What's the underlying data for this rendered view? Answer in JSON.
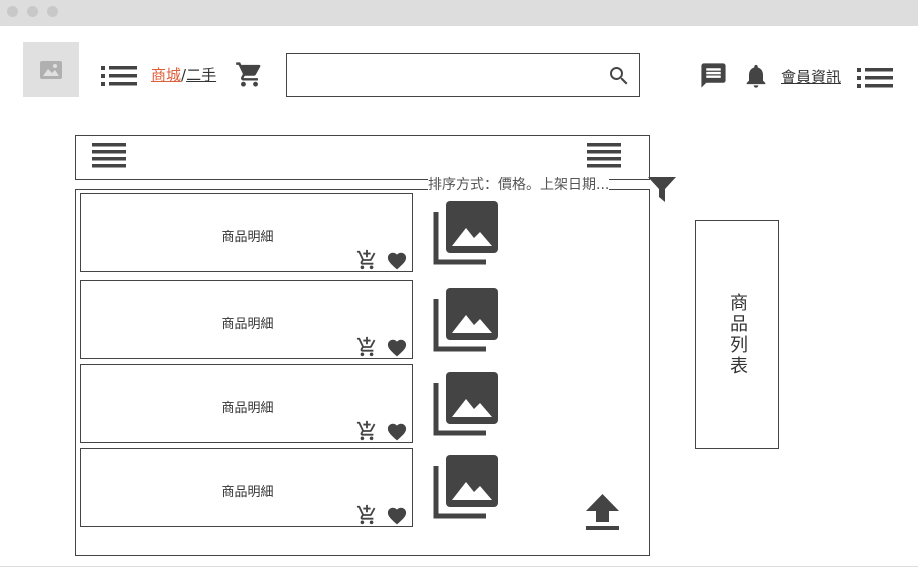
{
  "window": {
    "title": ""
  },
  "logo": {
    "icon": "image-placeholder-icon"
  },
  "header": {
    "menu_icon": "list-icon",
    "breadcrumb": {
      "active": "商城",
      "separator": "/",
      "next": "二手"
    },
    "cart_icon": "shopping-cart-icon",
    "search": {
      "value": "",
      "placeholder": "",
      "icon": "search-icon"
    },
    "message_icon": "message-icon",
    "bell_icon": "bell-icon",
    "member_label": "會員資訊",
    "right_menu_icon": "list-icon"
  },
  "toolbar": {
    "left_icon": "hamburger-icon",
    "right_icon": "hamburger-icon"
  },
  "sort": {
    "label": "排序方式：價格。上架日期...",
    "filter_icon": "filter-icon"
  },
  "products": [
    {
      "title": "商品明細",
      "cart_icon": "add-to-cart-icon",
      "fav_icon": "heart-icon",
      "image_icon": "photo-library-icon"
    },
    {
      "title": "商品明細",
      "cart_icon": "add-to-cart-icon",
      "fav_icon": "heart-icon",
      "image_icon": "photo-library-icon"
    },
    {
      "title": "商品明細",
      "cart_icon": "add-to-cart-icon",
      "fav_icon": "heart-icon",
      "image_icon": "photo-library-icon"
    },
    {
      "title": "商品明細",
      "cart_icon": "add-to-cart-icon",
      "fav_icon": "heart-icon",
      "image_icon": "photo-library-icon"
    }
  ],
  "scroll_top_icon": "upload-arrow-icon",
  "side_panel": {
    "label": "商品列表"
  },
  "colors": {
    "accent": "#e0603c",
    "icon": "#444444",
    "chrome": "#dddddd"
  }
}
